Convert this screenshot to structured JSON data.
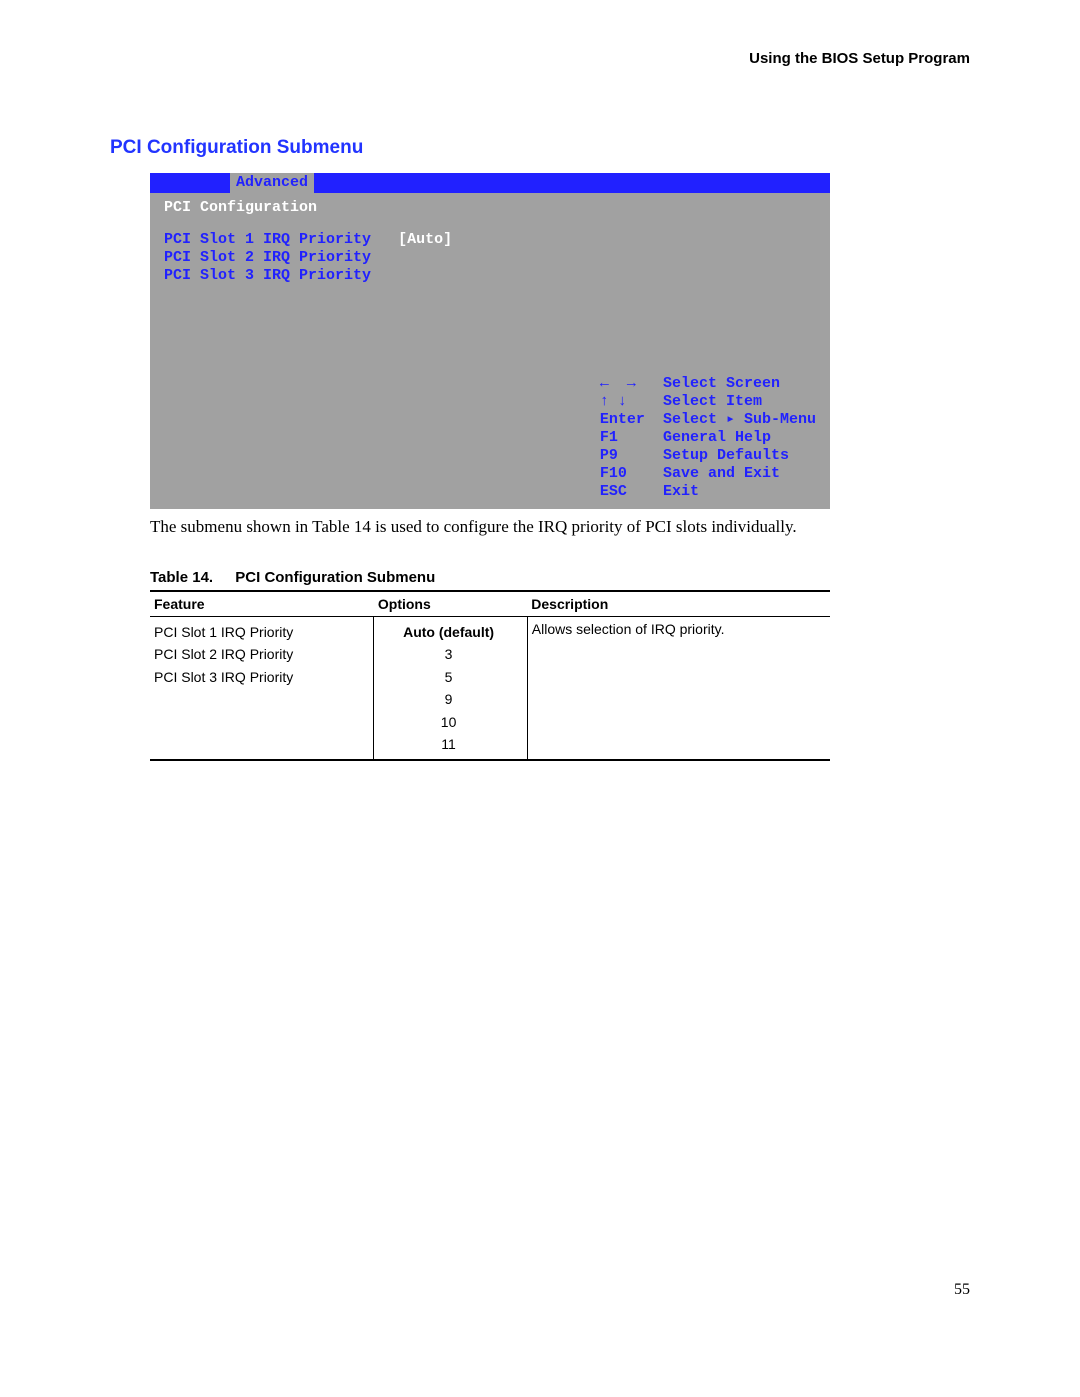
{
  "header": "Using the BIOS Setup Program",
  "section_title": "PCI Configuration Submenu",
  "bios": {
    "tab": "Advanced",
    "subtitle": "PCI Configuration",
    "rows": [
      {
        "label": "PCI Slot 1 IRQ Priority",
        "value": "[Auto]"
      },
      {
        "label": "PCI Slot 2 IRQ Priority",
        "value": ""
      },
      {
        "label": "PCI Slot 3 IRQ Priority",
        "value": ""
      }
    ],
    "keys": [
      {
        "k": "←  →",
        "v": "Select Screen"
      },
      {
        "k": "↑ ↓",
        "v": "Select Item"
      },
      {
        "k": "Enter",
        "v": "Select ▸ Sub-Menu"
      },
      {
        "k": "F1",
        "v": "General Help"
      },
      {
        "k": "P9",
        "v": "Setup Defaults"
      },
      {
        "k": "F10",
        "v": "Save and Exit"
      },
      {
        "k": "ESC",
        "v": "Exit"
      }
    ]
  },
  "caption": "The submenu shown in Table 14 is used to configure the IRQ priority of PCI slots individually.",
  "table": {
    "caption_label": "Table 14.",
    "caption_title": "PCI Configuration Submenu",
    "headers": {
      "c1": "Feature",
      "c2": "Options",
      "c3": "Description"
    },
    "features": [
      "PCI Slot 1 IRQ Priority",
      "PCI Slot 2 IRQ Priority",
      "PCI Slot 3 IRQ Priority"
    ],
    "options": [
      {
        "text": "Auto (default)",
        "bold": true
      },
      {
        "text": "3",
        "bold": false
      },
      {
        "text": "5",
        "bold": false
      },
      {
        "text": "9",
        "bold": false
      },
      {
        "text": "10",
        "bold": false
      },
      {
        "text": "11",
        "bold": false
      }
    ],
    "description": "Allows selection of IRQ priority."
  },
  "page_number": "55"
}
